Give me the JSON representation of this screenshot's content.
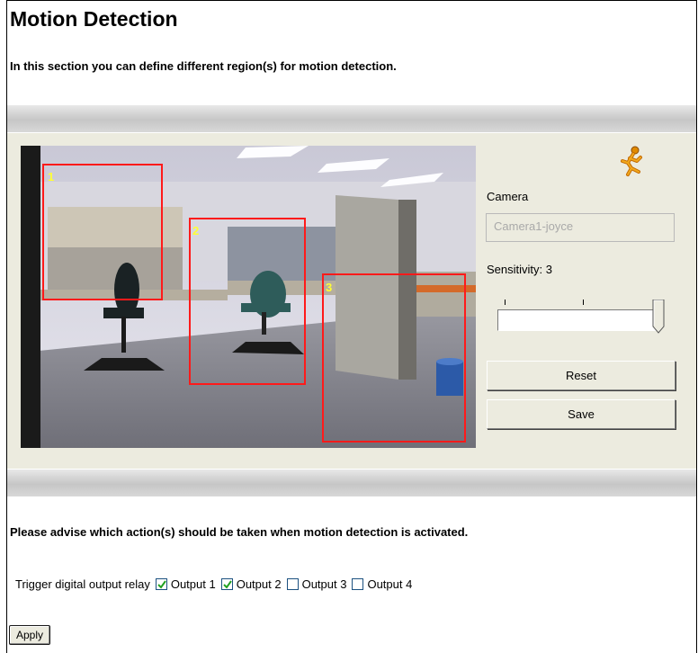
{
  "header": {
    "title": "Motion Detection",
    "intro": "In this section you can define different region(s) for motion detection."
  },
  "video": {
    "regions": [
      {
        "label": "1"
      },
      {
        "label": "2"
      },
      {
        "label": "3"
      }
    ],
    "region_color": "#ff1a1a",
    "region_label_color": "#ffff33"
  },
  "sidebar": {
    "camera_label": "Camera",
    "camera_value": "Camera1-joyce",
    "sensitivity_label": "Sensitivity: 3",
    "sensitivity_value": 3,
    "reset_label": "Reset",
    "save_label": "Save",
    "motion_icon": "running-man-icon"
  },
  "actions": {
    "advise": "Please advise which action(s) should be taken when motion detection is activated.",
    "trigger_label": "Trigger digital output relay",
    "outputs": [
      {
        "label": "Output 1",
        "checked": true
      },
      {
        "label": "Output 2",
        "checked": true
      },
      {
        "label": "Output 3",
        "checked": false
      },
      {
        "label": "Output 4",
        "checked": false
      }
    ],
    "apply_label": "Apply"
  },
  "colors": {
    "panel": "#ecebdf",
    "band": "#c6c6c6"
  }
}
